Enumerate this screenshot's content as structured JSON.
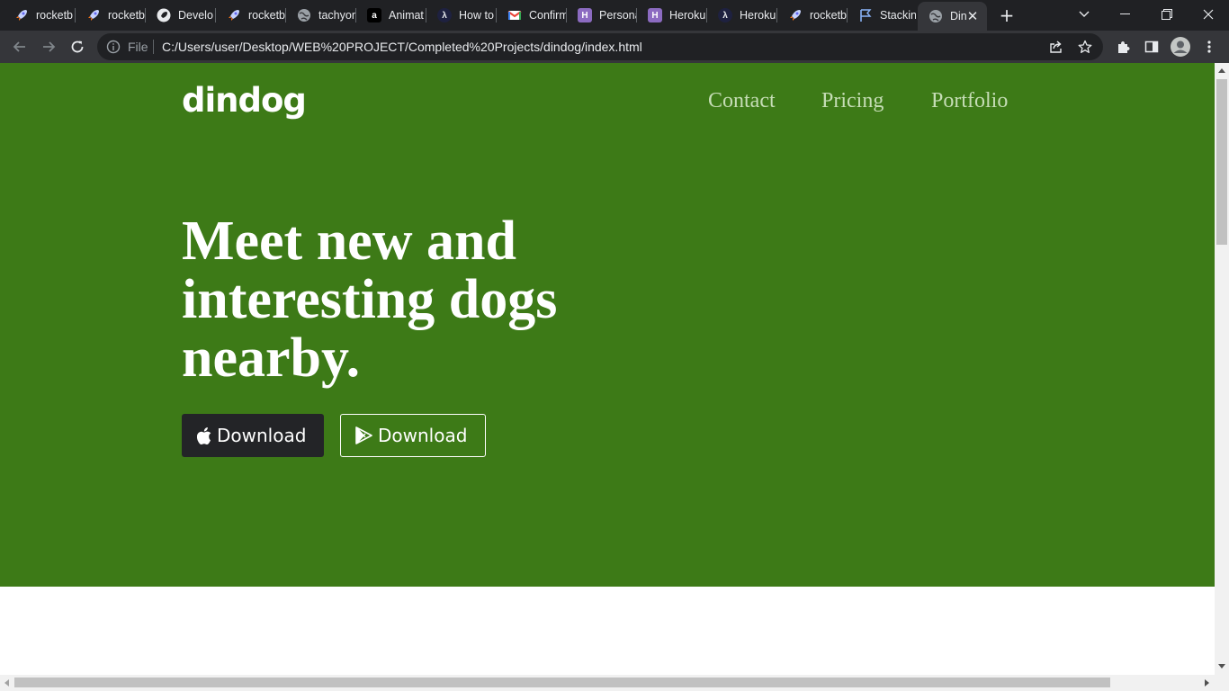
{
  "browser": {
    "tabs": [
      {
        "label": "rocketb",
        "icon": "rocket-icon"
      },
      {
        "label": "rocketb",
        "icon": "rocket-icon"
      },
      {
        "label": "Develo",
        "icon": "rocket-dark-icon"
      },
      {
        "label": "rocketb",
        "icon": "rocket-icon"
      },
      {
        "label": "tachyon",
        "icon": "globe-icon"
      },
      {
        "label": "Animat",
        "icon": "a-icon"
      },
      {
        "label": "How to",
        "icon": "lambda-icon"
      },
      {
        "label": "Confirm",
        "icon": "gmail-icon"
      },
      {
        "label": "Persona",
        "icon": "heroku-icon"
      },
      {
        "label": "Heroku",
        "icon": "heroku-icon"
      },
      {
        "label": "Heroku",
        "icon": "lambda-icon"
      },
      {
        "label": "rocketb",
        "icon": "rocket-icon"
      },
      {
        "label": "Stackin",
        "icon": "flag-icon"
      },
      {
        "label": "Din",
        "icon": "globe-icon",
        "active": true
      }
    ],
    "new_tab_label": "+",
    "omnibox": {
      "scheme_label": "File",
      "url": "C:/Users/user/Desktop/WEB%20PROJECT/Completed%20Projects/dindog/index.html"
    }
  },
  "site": {
    "brand": "dindog",
    "nav": {
      "contact": "Contact",
      "pricing": "Pricing",
      "portfolio": "Portfolio"
    },
    "hero": {
      "headline": "Meet new and interesting dogs nearby.",
      "apple_download": "Download",
      "play_download": "Download"
    }
  },
  "colors": {
    "hero_bg": "#3d7a17",
    "nav_link": "#c6ddb6",
    "apple_button_bg": "#232427",
    "browser_frame": "#202124",
    "toolbar": "#35363a"
  }
}
